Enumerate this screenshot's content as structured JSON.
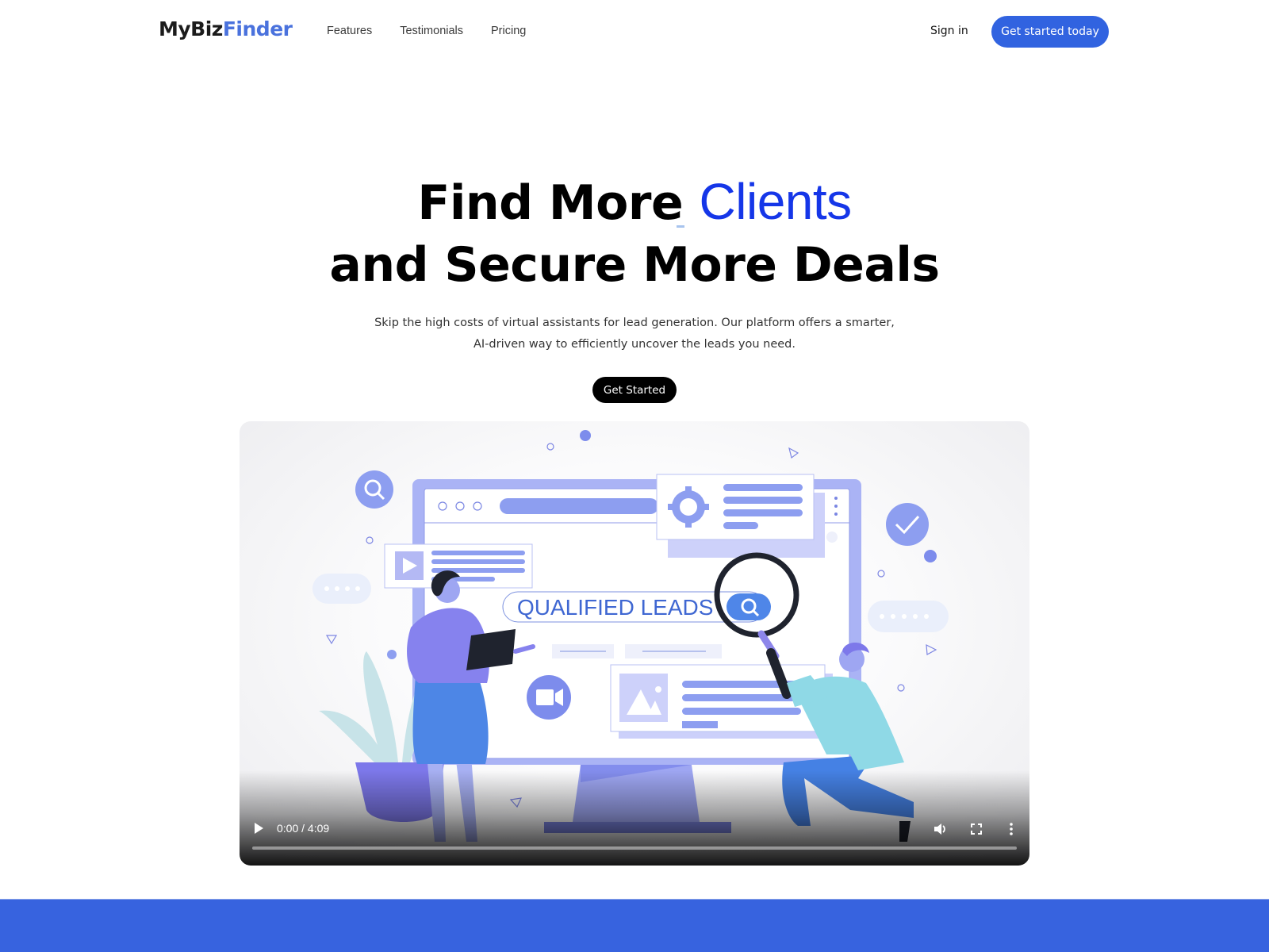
{
  "nav": {
    "logo": {
      "part1": "MyBiz",
      "part2": "Finder"
    },
    "links": [
      {
        "label": "Features"
      },
      {
        "label": "Testimonials"
      },
      {
        "label": "Pricing"
      }
    ],
    "sign_in": "Sign in",
    "cta": "Get started today"
  },
  "hero": {
    "title_line1_prefix": "Find More ",
    "title_line1_accent": "Clients",
    "title_line2": "and Secure More Deals",
    "subtitle_line1": "Skip the high costs of virtual assistants for lead generation. Our platform offers a smarter,",
    "subtitle_line2": "AI-driven way to efficiently uncover the leads you need.",
    "cta": "Get Started"
  },
  "video": {
    "illustration_search_text": "QUALIFIED LEADS",
    "current_time": "0:00",
    "duration": "4:09",
    "time_display": "0:00 / 4:09",
    "progress_fraction": 0,
    "controls": [
      "play-icon",
      "volume-icon",
      "fullscreen-icon",
      "more-options-icon"
    ]
  },
  "colors": {
    "brand_blue": "#3163e0",
    "accent_text": "#1536e8",
    "band": "#3763df"
  }
}
